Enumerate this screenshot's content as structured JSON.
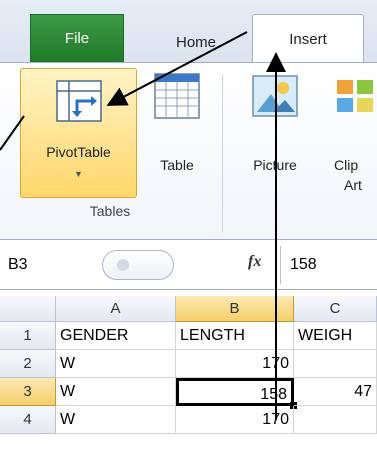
{
  "tabs": [
    {
      "label": "File"
    },
    {
      "label": "Home"
    },
    {
      "label": "Insert"
    }
  ],
  "ribbon": {
    "pivot_label": "PivotTable",
    "table_label": "Table",
    "picture_label": "Picture",
    "clip_label_line1": "Clip",
    "clip_label_line2": "Art",
    "group_label": "Tables"
  },
  "formula_bar": {
    "name_box": "B3",
    "fx": "fx",
    "value": "158"
  },
  "grid": {
    "columns": [
      "A",
      "B",
      "C"
    ],
    "rows": [
      {
        "num": "1",
        "a": "GENDER",
        "b": "LENGTH",
        "c": "WEIGH"
      },
      {
        "num": "2",
        "a": "W",
        "b": "170",
        "c": ""
      },
      {
        "num": "3",
        "a": "W",
        "b": "158",
        "c": "47"
      },
      {
        "num": "4",
        "a": "W",
        "b": "170",
        "c": ""
      }
    ]
  },
  "colors": {
    "file_tab": "#2e8b3c",
    "selection_border": "#000000",
    "highlight": "#f6cf6a"
  }
}
